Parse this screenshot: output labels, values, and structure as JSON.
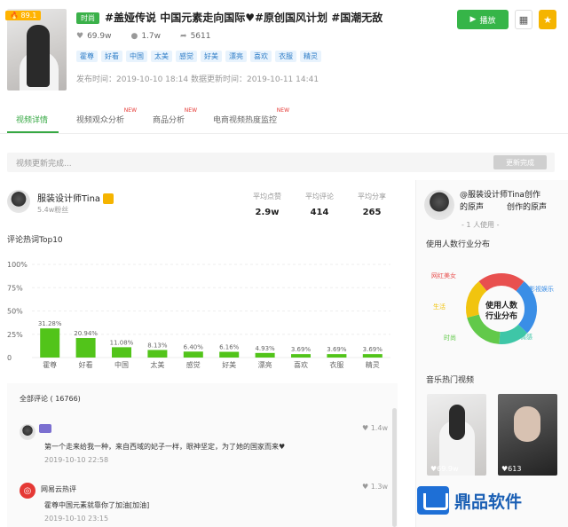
{
  "video": {
    "score": "89.1",
    "category": "时尚",
    "title": "#盖娅传说 中国元素走向国际♥#原创国风计划 #国潮无敌",
    "likes": "69.9w",
    "comments": "1.7w",
    "shares": "5611",
    "keywords": [
      "霍尊",
      "好看",
      "中国",
      "太美",
      "感觉",
      "好美",
      "漂亮",
      "喜欢",
      "衣服",
      "精灵"
    ],
    "times": "发布时间：2019-10-10 18:14 数据更新时间：2019-10-11 14:41",
    "play_label": "播放"
  },
  "tabs": [
    {
      "label": "视频详情",
      "new": ""
    },
    {
      "label": "视频观众分析",
      "new": "NEW"
    },
    {
      "label": "商品分析",
      "new": "NEW"
    },
    {
      "label": "电商视频热度监控",
      "new": "NEW"
    }
  ],
  "update": {
    "text": "视频更新完成...",
    "button": "更新完成"
  },
  "author": {
    "name": "服装设计师Tina",
    "fans": "5.4w粉丝",
    "metrics": [
      {
        "label": "平均点赞",
        "value": "2.9w"
      },
      {
        "label": "平均评论",
        "value": "414"
      },
      {
        "label": "平均分享",
        "value": "265"
      }
    ]
  },
  "chart_section_title": "评论热词Top10",
  "chart_data": {
    "type": "bar",
    "categories": [
      "霍尊",
      "好看",
      "中国",
      "太美",
      "感觉",
      "好美",
      "漂亮",
      "喜欢",
      "衣服",
      "精灵"
    ],
    "values": [
      31.28,
      20.94,
      11.08,
      8.13,
      6.4,
      6.16,
      4.93,
      3.69,
      3.69,
      3.69
    ],
    "value_labels": [
      "31.28%",
      "20.94%",
      "11.08%",
      "8.13%",
      "6.40%",
      "6.16%",
      "4.93%",
      "3.69%",
      "3.69%",
      "3.69%"
    ],
    "yticks": [
      "100%",
      "75%",
      "50%",
      "25%",
      "0"
    ],
    "ylim": [
      0,
      100
    ],
    "color": "#52c41a"
  },
  "comments": {
    "header": "全部评论 ( 16766)",
    "items": [
      {
        "user": "",
        "text": "第一个走来给我一种，来自西域的妃子一样，眼神坚定，为了她的国家而来♥",
        "time": "2019-10-10 22:58",
        "likes": "1.4w"
      },
      {
        "user": "网易云热评",
        "text": "霍尊中国元素就靠你了加油[加油]",
        "time": "2019-10-10 23:15",
        "likes": "1.3w"
      }
    ]
  },
  "music": {
    "name": "@服装设计师Tina创作的原声",
    "name_line1": "@服装设计师Tina创作",
    "name_line2a": "的原声",
    "name_line2b": "创作的原声",
    "users": "- 1 人使用 -",
    "dist_title": "使用人数行业分布",
    "donut_center": "使用人数行业分布",
    "donut_center_l1": "使用人数",
    "donut_center_l2": "行业分布",
    "segments": [
      {
        "label": "网红美女",
        "color": "#e8504f"
      },
      {
        "label": "影视娱乐",
        "color": "#3a8ee6"
      },
      {
        "label": "情感",
        "color": "#3ec6a7"
      },
      {
        "label": "时尚",
        "color": "#62c94a"
      },
      {
        "label": "生活",
        "color": "#f1c40f"
      }
    ],
    "hot_title": "音乐热门视频",
    "hot_videos": [
      {
        "likes": "69.9w"
      },
      {
        "likes": "613"
      }
    ]
  },
  "watermark": {
    "text": "鼎品软件"
  }
}
